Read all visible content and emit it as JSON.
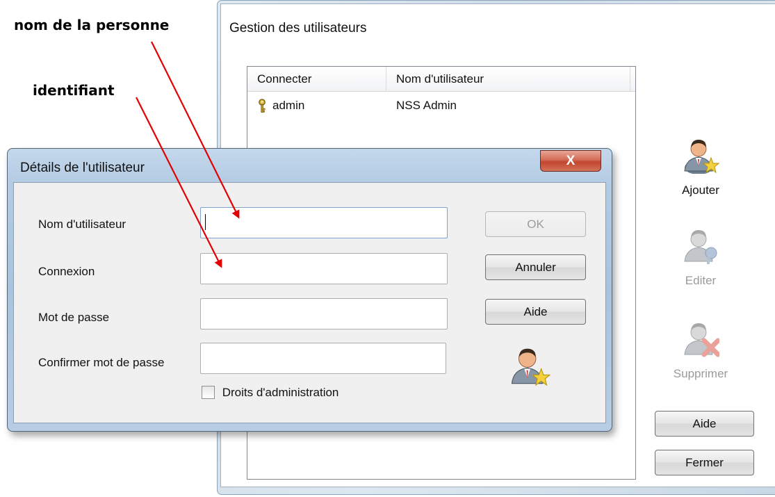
{
  "annotations": {
    "person_name": "nom de la personne",
    "identifier": "identifiant"
  },
  "users_window": {
    "title": "Gestion des utilisateurs",
    "columns": [
      "Connecter",
      "Nom d'utilisateur"
    ],
    "rows": [
      {
        "login": "admin",
        "name": "NSS Admin"
      }
    ],
    "actions": {
      "add": "Ajouter",
      "edit": "Editer",
      "delete": "Supprimer"
    },
    "buttons": {
      "help": "Aide",
      "close": "Fermer"
    }
  },
  "details_dialog": {
    "title": "Détails de l'utilisateur",
    "close_glyph": "X",
    "fields": {
      "username_label": "Nom d'utilisateur",
      "username_value": "",
      "login_label": "Connexion",
      "login_value": "",
      "password_label": "Mot de passe",
      "password_value": "",
      "confirm_label": "Confirmer mot de passe",
      "confirm_value": ""
    },
    "admin_checkbox": {
      "label": "Droits d'administration",
      "checked": false
    },
    "buttons": {
      "ok": "OK",
      "cancel": "Annuler",
      "help": "Aide"
    }
  },
  "colors": {
    "arrow": "#e30000",
    "disabled_text": "#9a9a9a",
    "close_button": "#c2462d"
  },
  "icons": {
    "key": "key-icon",
    "add_user": "user-add-icon",
    "edit_user": "user-edit-icon",
    "delete_user": "user-delete-icon"
  }
}
